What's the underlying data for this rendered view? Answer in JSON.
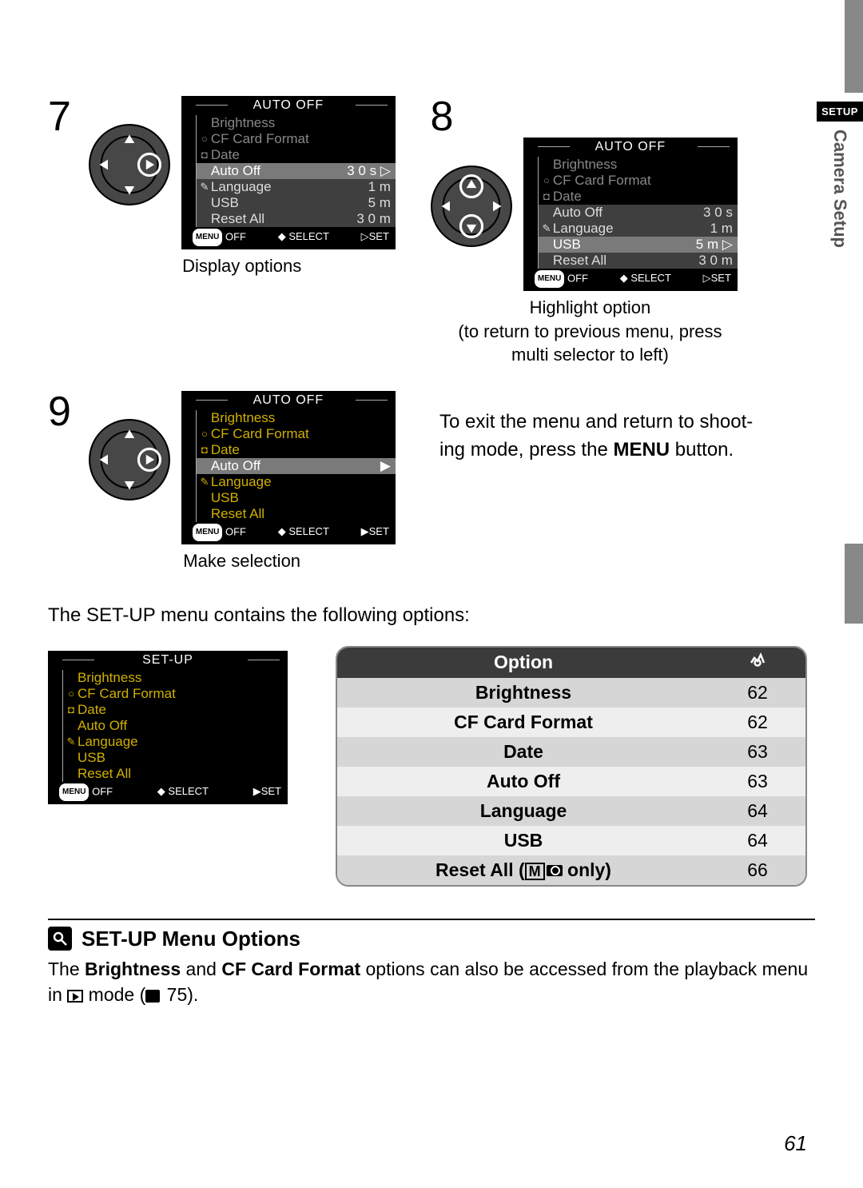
{
  "page_number": "61",
  "side_tab": {
    "badge": "SETUP",
    "label": "Camera Setup"
  },
  "steps": [
    {
      "num": "7",
      "caption": "Display options",
      "dpad": "right",
      "screen": {
        "title": "AUTO OFF",
        "items": [
          {
            "icon": "",
            "label": "Brightness",
            "val": "",
            "cls": ""
          },
          {
            "icon": "○",
            "label": "CF Card Format",
            "val": "",
            "cls": ""
          },
          {
            "icon": "◘",
            "label": "Date",
            "val": "",
            "cls": ""
          },
          {
            "icon": "",
            "label": "Auto Off",
            "val": "3 0 s ▷",
            "cls": "hl"
          },
          {
            "icon": "✎",
            "label": "Language",
            "val": "1 m",
            "cls": "opt"
          },
          {
            "icon": "",
            "label": "USB",
            "val": "5 m",
            "cls": "opt"
          },
          {
            "icon": "",
            "label": "Reset All",
            "val": "3 0 m",
            "cls": "opt"
          }
        ],
        "foot": {
          "a": "OFF",
          "b": "SELECT",
          "c": "SET",
          "arrow": "▷"
        }
      }
    },
    {
      "num": "8",
      "caption": "Highlight option\n(to return to previous menu, press\nmulti selector to left)",
      "dpad": "updown",
      "screen": {
        "title": "AUTO OFF",
        "items": [
          {
            "icon": "",
            "label": "Brightness",
            "val": "",
            "cls": ""
          },
          {
            "icon": "○",
            "label": "CF Card Format",
            "val": "",
            "cls": ""
          },
          {
            "icon": "◘",
            "label": "Date",
            "val": "",
            "cls": ""
          },
          {
            "icon": "",
            "label": "Auto Off",
            "val": "3 0 s",
            "cls": "opt"
          },
          {
            "icon": "✎",
            "label": "Language",
            "val": "1 m",
            "cls": "opt"
          },
          {
            "icon": "",
            "label": "USB",
            "val": "5 m ▷",
            "cls": "optsel"
          },
          {
            "icon": "",
            "label": "Reset All",
            "val": "3 0 m",
            "cls": "opt"
          }
        ],
        "foot": {
          "a": "OFF",
          "b": "SELECT",
          "c": "SET",
          "arrow": "▷"
        }
      }
    },
    {
      "num": "9",
      "caption": "Make selection",
      "dpad": "right",
      "screen": {
        "title": "AUTO OFF",
        "items": [
          {
            "icon": "",
            "label": "Brightness",
            "val": "",
            "cls": "yellow-all"
          },
          {
            "icon": "○",
            "label": "CF Card Format",
            "val": "",
            "cls": "yellow-all"
          },
          {
            "icon": "◘",
            "label": "Date",
            "val": "",
            "cls": "yellow-all"
          },
          {
            "icon": "",
            "label": "Auto Off",
            "val": "▶",
            "cls": "hl"
          },
          {
            "icon": "✎",
            "label": "Language",
            "val": "",
            "cls": "yellow-all"
          },
          {
            "icon": "",
            "label": "USB",
            "val": "",
            "cls": "yellow-all"
          },
          {
            "icon": "",
            "label": "Reset All",
            "val": "",
            "cls": "yellow-all"
          }
        ],
        "foot": {
          "a": "OFF",
          "b": "SELECT",
          "c": "SET",
          "arrow": "▶"
        }
      }
    }
  ],
  "exit_text_1": "To exit the menu and return to shoot-",
  "exit_text_2a": "ing mode, press the ",
  "exit_text_2b": "MENU",
  "exit_text_2c": " button.",
  "intro": "The SET-UP menu contains the following options:",
  "setup_screen": {
    "title": "SET-UP",
    "items": [
      {
        "icon": "",
        "label": "Brightness"
      },
      {
        "icon": "○",
        "label": "CF Card Format"
      },
      {
        "icon": "◘",
        "label": "Date"
      },
      {
        "icon": "",
        "label": "Auto Off"
      },
      {
        "icon": "✎",
        "label": "Language"
      },
      {
        "icon": "",
        "label": "USB"
      },
      {
        "icon": "",
        "label": "Reset All"
      }
    ],
    "foot": {
      "a": "OFF",
      "b": "SELECT",
      "c": "SET",
      "arrow": "▶"
    }
  },
  "table": {
    "header": {
      "c1": "Option",
      "c2": "☉"
    },
    "rows": [
      {
        "c1": "Brightness",
        "c2": "62"
      },
      {
        "c1": "CF Card Format",
        "c2": "62"
      },
      {
        "c1": "Date",
        "c2": "63"
      },
      {
        "c1": "Auto Off",
        "c2": "63"
      },
      {
        "c1": "Language",
        "c2": "64"
      },
      {
        "c1": "USB",
        "c2": "64"
      },
      {
        "c1": "Reset All (Ⓜ📷 only)",
        "c2": "66"
      }
    ]
  },
  "note": {
    "title": "SET-UP Menu Options",
    "body_a": "The ",
    "body_b": "Brightness",
    "body_c": " and ",
    "body_d": "CF Card Format",
    "body_e": " options can also be accessed from the playback menu in ",
    "body_f": " mode (",
    "body_g": " 75)."
  }
}
